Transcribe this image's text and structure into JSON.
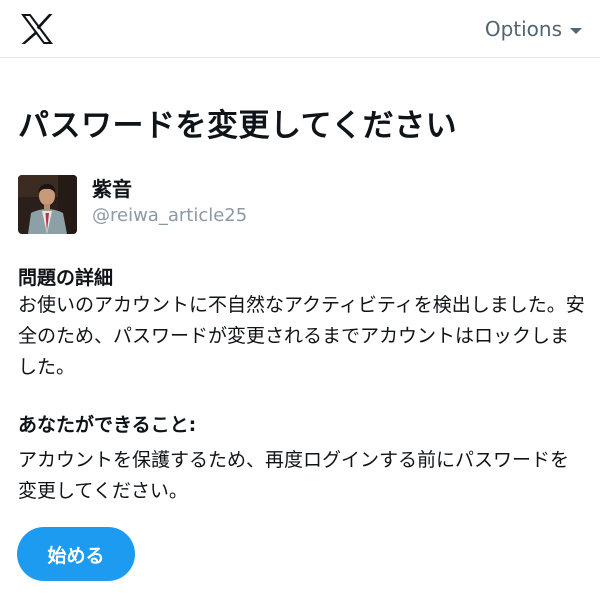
{
  "header": {
    "logo_icon": "x-logo-icon",
    "options_label": "Options"
  },
  "page_title": "パスワードを変更してください",
  "account": {
    "display_name": "紫音",
    "handle": "@reiwa_article25"
  },
  "problem": {
    "heading": "問題の詳細",
    "body": "お使いのアカウントに不自然なアクティビティを検出しました。安全のため、パスワードが変更されるまでアカウントはロックしました。"
  },
  "action": {
    "heading": "あなたができること:",
    "body": "アカウントを保護するため、再度ログインする前にパスワードを変更してください。"
  },
  "start_button_label": "始める",
  "colors": {
    "accent": "#1d9bf0",
    "muted_text": "#536471",
    "handle_text": "#8b98a5"
  }
}
